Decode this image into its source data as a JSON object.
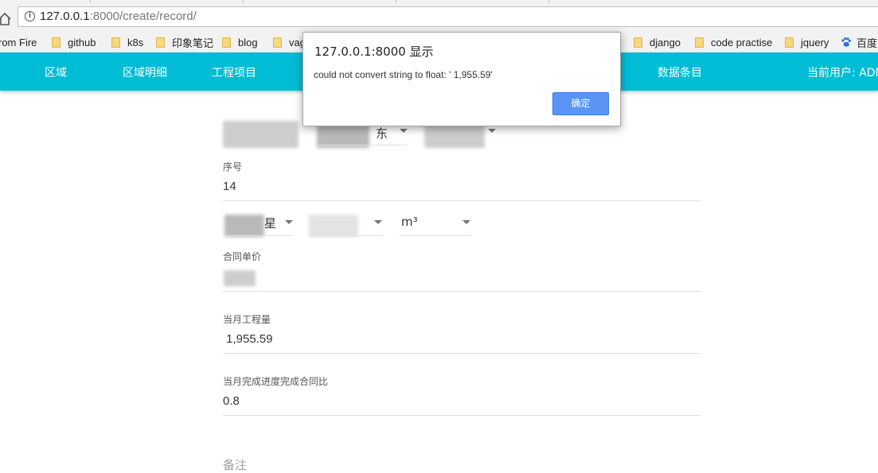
{
  "browser": {
    "url_host": "127.0.0.1",
    "url_port_path": ":8000/create/record/",
    "bookmarks": [
      {
        "label": "rom Fire",
        "icon": "none"
      },
      {
        "label": "github",
        "icon": "folder-icon"
      },
      {
        "label": "k8s",
        "icon": "folder-icon"
      },
      {
        "label": "印象笔记",
        "icon": "folder-icon"
      },
      {
        "label": "blog",
        "icon": "folder-icon"
      },
      {
        "label": "vag",
        "icon": "folder-icon"
      },
      {
        "label": "django",
        "icon": "folder-icon"
      },
      {
        "label": "code practise",
        "icon": "folder-icon"
      },
      {
        "label": "jquery",
        "icon": "folder-icon"
      },
      {
        "label": "百度",
        "icon": "baidu-paw-icon"
      }
    ]
  },
  "nav": {
    "items": [
      "区域",
      "区域明细",
      "工程项目",
      "数据条目"
    ],
    "current_user": "当前用户: ADM",
    "bar_color": "#00bcd4"
  },
  "form": {
    "select1_fragment": "东",
    "serial_label": "序号",
    "serial_value": "14",
    "select_project_fragment": "星",
    "unit_value": "m³",
    "unit_price_label": "合同单价",
    "monthly_qty_label": "当月工程量",
    "monthly_qty_value": " 1,955.59",
    "progress_label": "当月完成进度完成合同比",
    "progress_value": "0.8",
    "remark_label": "备注"
  },
  "dialog": {
    "title": "127.0.0.1:8000 显示",
    "message": "could not convert string to float: ' 1,955.59'",
    "ok_label": "确定",
    "button_color": "#5a95f5"
  }
}
